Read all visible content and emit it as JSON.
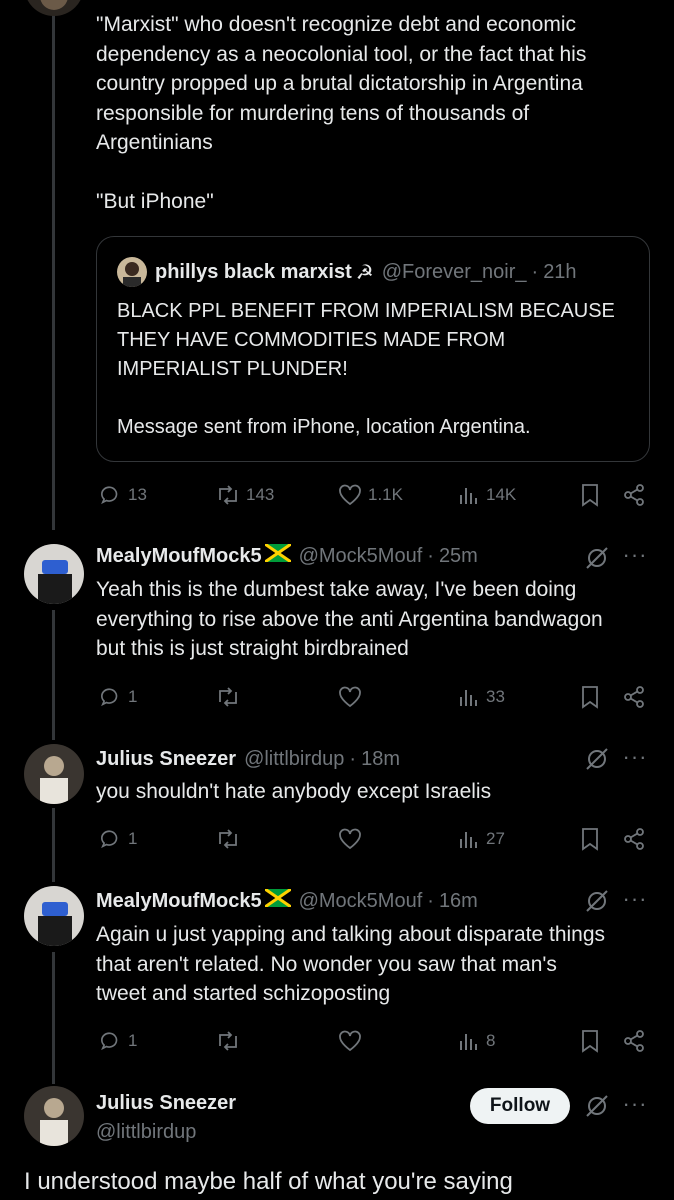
{
  "colors": {
    "background": "#000000",
    "text": "#e7e9ea",
    "muted": "#71767b",
    "border": "#333639",
    "follow_bg": "#eff3f4"
  },
  "main_tweet": {
    "text": "\"Marxist\" who doesn't recognize debt and economic\ndependency as a neocolonial tool, or the fact that his\ncountry propped up a brutal dictatorship in Argentina\nresponsible for murdering tens of thousands of\nArgentinians\n\n\"But iPhone\"",
    "quote": {
      "name": "phillys black marxist",
      "name_emoji": "☭",
      "handle": "@Forever_noir_",
      "time": "21h",
      "text": "BLACK PPL BENEFIT FROM IMPERIALISM BECAUSE\nTHEY HAVE COMMODITIES MADE FROM\nIMPERIALIST PLUNDER!\n\nMessage sent from iPhone, location Argentina."
    },
    "stats": {
      "replies": "13",
      "reposts": "143",
      "likes": "1.1K",
      "views": "14K"
    }
  },
  "replies": [
    {
      "name": "MealyMoufMock5",
      "handle": "@Mock5Mouf",
      "time": "25m",
      "text": "Yeah this is the dumbest take away, I've been doing\neverything to rise above the anti Argentina bandwagon\nbut this is just straight birdbrained",
      "stats": {
        "replies": "1",
        "reposts": "",
        "likes": "",
        "views": "33"
      }
    },
    {
      "name": "Julius Sneezer",
      "handle": "@littlbirdup",
      "time": "18m",
      "text": "you shouldn't hate anybody except Israelis",
      "stats": {
        "replies": "1",
        "reposts": "",
        "likes": "",
        "views": "27"
      }
    },
    {
      "name": "MealyMoufMock5",
      "handle": "@Mock5Mouf",
      "time": "16m",
      "text": "Again u just yapping and talking about disparate things\nthat aren't related. No wonder you saw that man's\ntweet and started schizoposting",
      "stats": {
        "replies": "1",
        "reposts": "",
        "likes": "",
        "views": "8"
      }
    }
  ],
  "focused_reply": {
    "name": "Julius Sneezer",
    "handle": "@littlbirdup",
    "follow_label": "Follow",
    "text": "I understood maybe half of what you're saying"
  },
  "ui": {
    "separator": "·",
    "more": "···"
  }
}
